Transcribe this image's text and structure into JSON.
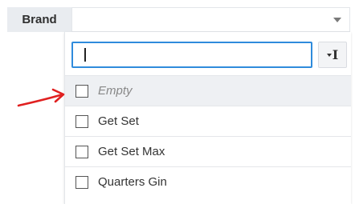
{
  "filter": {
    "label": "Brand",
    "selected_value": ""
  },
  "dropdown": {
    "search": {
      "value": "",
      "placeholder": ""
    },
    "text_mode_icon": "text-cursor-icon",
    "options": [
      {
        "label": "Empty",
        "checked": false,
        "italic": true
      },
      {
        "label": "Get Set",
        "checked": false
      },
      {
        "label": "Get Set Max",
        "checked": false
      },
      {
        "label": "Quarters Gin",
        "checked": false
      }
    ]
  },
  "annotation": {
    "type": "arrow",
    "color": "#e02020",
    "points_to": "Empty"
  },
  "colors": {
    "label_bg": "#e9ecf0",
    "focus_border": "#2f8bdc",
    "highlight_row": "#eef0f3"
  }
}
